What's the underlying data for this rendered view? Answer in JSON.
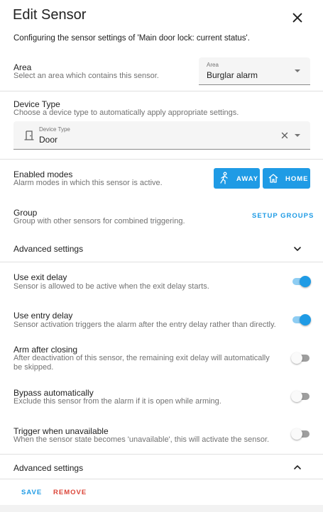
{
  "dialog": {
    "title": "Edit Sensor",
    "subtitle": "Configuring the sensor settings of 'Main door lock: current status'."
  },
  "area": {
    "label": "Area",
    "description": "Select an area which contains this sensor.",
    "field_label": "Area",
    "value": "Burglar alarm"
  },
  "device_type": {
    "label": "Device Type",
    "description": "Choose a device type to automatically apply appropriate settings.",
    "field_label": "Device Type",
    "value": "Door",
    "icon": "door-icon"
  },
  "enabled_modes": {
    "label": "Enabled modes",
    "description": "Alarm modes in which this sensor is active.",
    "modes": [
      {
        "label": "AWAY",
        "icon": "walking-icon",
        "active": true
      },
      {
        "label": "HOME",
        "icon": "home-icon",
        "active": true
      }
    ]
  },
  "group": {
    "label": "Group",
    "description": "Group with other sensors for combined triggering.",
    "action": "SETUP GROUPS"
  },
  "advanced_top": {
    "label": "Advanced settings"
  },
  "options": [
    {
      "label": "Use exit delay",
      "description": "Sensor is allowed to be active when the exit delay starts.",
      "enabled": true
    },
    {
      "label": "Use entry delay",
      "description": "Sensor activation triggers the alarm after the entry delay rather than directly.",
      "enabled": true
    },
    {
      "label": "Arm after closing",
      "description": "After deactivation of this sensor, the remaining exit delay will automatically be skipped.",
      "enabled": false
    },
    {
      "label": "Bypass automatically",
      "description": "Exclude this sensor from the alarm if it is open while arming.",
      "enabled": false
    },
    {
      "label": "Trigger when unavailable",
      "description": "When the sensor state becomes 'unavailable', this will activate the sensor.",
      "enabled": false
    }
  ],
  "advanced_bottom": {
    "label": "Advanced settings"
  },
  "footer": {
    "save": "SAVE",
    "remove": "REMOVE"
  },
  "colors": {
    "accent": "#1f9be5",
    "danger": "#db4437"
  }
}
